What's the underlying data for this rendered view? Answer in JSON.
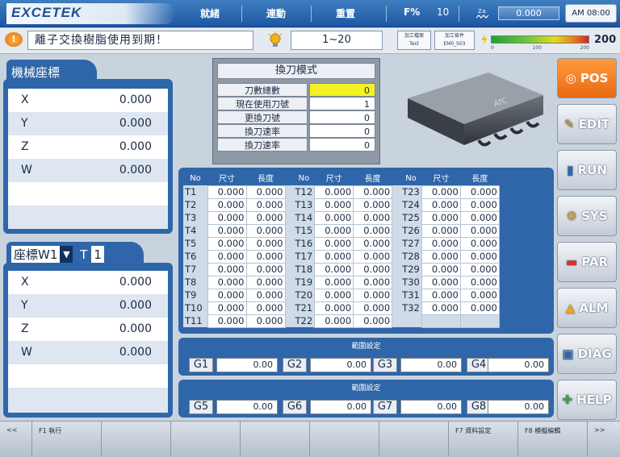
{
  "header": {
    "logo": "EXCETEK",
    "mode_items": [
      "就緒",
      "連動",
      "重置"
    ],
    "feed_label": "F%",
    "feed_value": "10",
    "feed_display": "0.000",
    "clock": "AM 08:00"
  },
  "alarm_bar": {
    "icon": "!",
    "message": "離子交換樹脂使用到期！",
    "range": "1~20",
    "box1_line1": "加工檔案",
    "box1_line2": "Test",
    "box2_line1": "加工條件",
    "box2_line2": "EM0_S03",
    "load_value": "200"
  },
  "machine_coords": {
    "title": "機械座標",
    "rows": [
      {
        "axis": "X",
        "value": "0.000"
      },
      {
        "axis": "Y",
        "value": "0.000"
      },
      {
        "axis": "Z",
        "value": "0.000"
      },
      {
        "axis": "W",
        "value": "0.000"
      }
    ]
  },
  "work_coords": {
    "label": "座標",
    "system": "W1",
    "t_label": "T",
    "t_value": "1",
    "rows": [
      {
        "axis": "X",
        "value": "0.000"
      },
      {
        "axis": "Y",
        "value": "0.000"
      },
      {
        "axis": "Z",
        "value": "0.000"
      },
      {
        "axis": "W",
        "value": "0.000"
      }
    ]
  },
  "atc_info": {
    "title": "換刀模式",
    "rows": [
      {
        "label": "刀數總數",
        "value": "0"
      },
      {
        "label": "現在使用刀號",
        "value": "1"
      },
      {
        "label": "更換刀號",
        "value": "0"
      },
      {
        "label": "換刀速率",
        "value": "0"
      },
      {
        "label": "換刀速率",
        "value": "0"
      }
    ],
    "image_text": "ATC"
  },
  "tool_table": {
    "headers": [
      "No",
      "尺寸",
      "長度"
    ],
    "columns": [
      {
        "tools": [
          [
            "T1",
            "0.000",
            "0.000"
          ],
          [
            "T2",
            "0.000",
            "0.000"
          ],
          [
            "T3",
            "0.000",
            "0.000"
          ],
          [
            "T4",
            "0.000",
            "0.000"
          ],
          [
            "T5",
            "0.000",
            "0.000"
          ],
          [
            "T6",
            "0.000",
            "0.000"
          ],
          [
            "T7",
            "0.000",
            "0.000"
          ],
          [
            "T8",
            "0.000",
            "0.000"
          ],
          [
            "T9",
            "0.000",
            "0.000"
          ],
          [
            "T10",
            "0.000",
            "0.000"
          ],
          [
            "T11",
            "0.000",
            "0.000"
          ]
        ]
      },
      {
        "tools": [
          [
            "T12",
            "0.000",
            "0.000"
          ],
          [
            "T13",
            "0.000",
            "0.000"
          ],
          [
            "T14",
            "0.000",
            "0.000"
          ],
          [
            "T15",
            "0.000",
            "0.000"
          ],
          [
            "T16",
            "0.000",
            "0.000"
          ],
          [
            "T17",
            "0.000",
            "0.000"
          ],
          [
            "T18",
            "0.000",
            "0.000"
          ],
          [
            "T19",
            "0.000",
            "0.000"
          ],
          [
            "T20",
            "0.000",
            "0.000"
          ],
          [
            "T21",
            "0.000",
            "0.000"
          ],
          [
            "T22",
            "0.000",
            "0.000"
          ]
        ]
      },
      {
        "tools": [
          [
            "T23",
            "0.000",
            "0.000"
          ],
          [
            "T24",
            "0.000",
            "0.000"
          ],
          [
            "T25",
            "0.000",
            "0.000"
          ],
          [
            "T26",
            "0.000",
            "0.000"
          ],
          [
            "T27",
            "0.000",
            "0.000"
          ],
          [
            "T28",
            "0.000",
            "0.000"
          ],
          [
            "T29",
            "0.000",
            "0.000"
          ],
          [
            "T30",
            "0.000",
            "0.000"
          ],
          [
            "T31",
            "0.000",
            "0.000"
          ],
          [
            "T32",
            "0.000",
            "0.000"
          ]
        ]
      }
    ]
  },
  "g_settings": [
    {
      "title": "範圍設定",
      "items": [
        {
          "label": "G1",
          "value": "0.00"
        },
        {
          "label": "G2",
          "value": "0.00"
        },
        {
          "label": "G3",
          "value": "0.00"
        },
        {
          "label": "G4",
          "value": "0.00"
        }
      ]
    },
    {
      "title": "範圍設定",
      "items": [
        {
          "label": "G5",
          "value": "0.00"
        },
        {
          "label": "G6",
          "value": "0.00"
        },
        {
          "label": "G7",
          "value": "0.00"
        },
        {
          "label": "G8",
          "value": "0.00"
        }
      ]
    }
  ],
  "side_buttons": [
    {
      "label": "POS",
      "icon": "target-icon",
      "active": true
    },
    {
      "label": "EDIT",
      "icon": "edit-icon",
      "active": false
    },
    {
      "label": "RUN",
      "icon": "run-icon",
      "active": false
    },
    {
      "label": "SYS",
      "icon": "system-icon",
      "active": false
    },
    {
      "label": "PAR",
      "icon": "parameter-icon",
      "active": false
    },
    {
      "label": "ALM",
      "icon": "alarm-icon",
      "active": false
    },
    {
      "label": "DIAG",
      "icon": "diagnose-icon",
      "active": false
    },
    {
      "label": "HELP",
      "icon": "help-icon",
      "active": false
    }
  ],
  "bottom_bar": {
    "prev": "<<",
    "f1": "F1 執行",
    "f7": "F7 資料設定",
    "f8": "F8 模擬編輯",
    "next": ">>"
  },
  "colors": {
    "panel_blue": "#2f66a9",
    "active_orange": "#f07a1f",
    "highlight_yellow": "#ffff00"
  }
}
